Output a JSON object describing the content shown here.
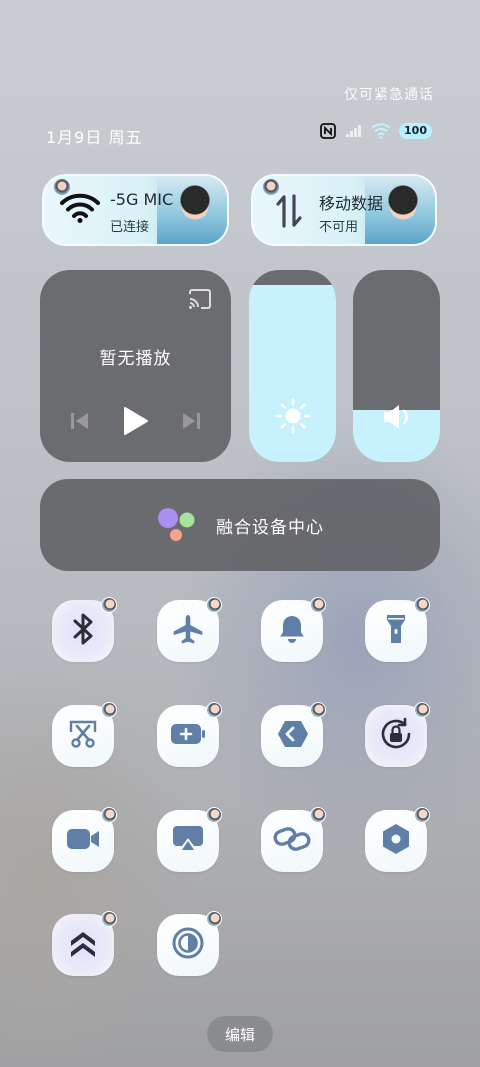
{
  "status": {
    "emergency_text": "仅可紧急通话",
    "date": "1月9日 周五",
    "battery": "100",
    "icons": [
      "nfc-icon",
      "signal-icon",
      "wifi-icon"
    ]
  },
  "wifi_card": {
    "title": "-5G   MIC",
    "subtitle": "已连接",
    "icon": "wifi-icon"
  },
  "data_card": {
    "title": "移动数据",
    "subtitle": "不可用",
    "icon": "data-arrows-icon"
  },
  "media": {
    "now_playing": "暂无播放",
    "icons": [
      "cast-icon",
      "previous-icon",
      "play-icon",
      "next-icon"
    ]
  },
  "brightness": {
    "level": 0.92,
    "icon": "sun-icon"
  },
  "volume": {
    "level": 0.27,
    "icon": "speaker-icon"
  },
  "fusion": {
    "label": "融合设备中心",
    "icon": "fusion-dots-icon"
  },
  "toggles": [
    {
      "name": "bluetooth",
      "icon": "bluetooth-icon",
      "active": true
    },
    {
      "name": "airplane",
      "icon": "airplane-icon",
      "active": false
    },
    {
      "name": "bell",
      "icon": "bell-icon",
      "active": false
    },
    {
      "name": "flashlight",
      "icon": "flashlight-icon",
      "active": false
    },
    {
      "name": "screenshot",
      "icon": "scissors-icon",
      "active": false
    },
    {
      "name": "battery-saver",
      "icon": "battery-plus-icon",
      "active": false
    },
    {
      "name": "nearby-share",
      "icon": "share-chevron-icon",
      "active": false
    },
    {
      "name": "rotation-lock",
      "icon": "rotation-lock-icon",
      "active": true
    },
    {
      "name": "screen-record",
      "icon": "video-icon",
      "active": false
    },
    {
      "name": "screen-cast",
      "icon": "airplay-icon",
      "active": false
    },
    {
      "name": "link",
      "icon": "link-icon",
      "active": false
    },
    {
      "name": "settings",
      "icon": "hexagon-icon",
      "active": false
    },
    {
      "name": "performance",
      "icon": "double-chevron-up-icon",
      "active": true
    },
    {
      "name": "dark-mode",
      "icon": "contrast-icon",
      "active": false
    }
  ],
  "edit_label": "编辑",
  "colors": {
    "accent": "#c7f2fd",
    "icon": "#5f7fa6",
    "icon_dark": "#2b2d3a"
  }
}
